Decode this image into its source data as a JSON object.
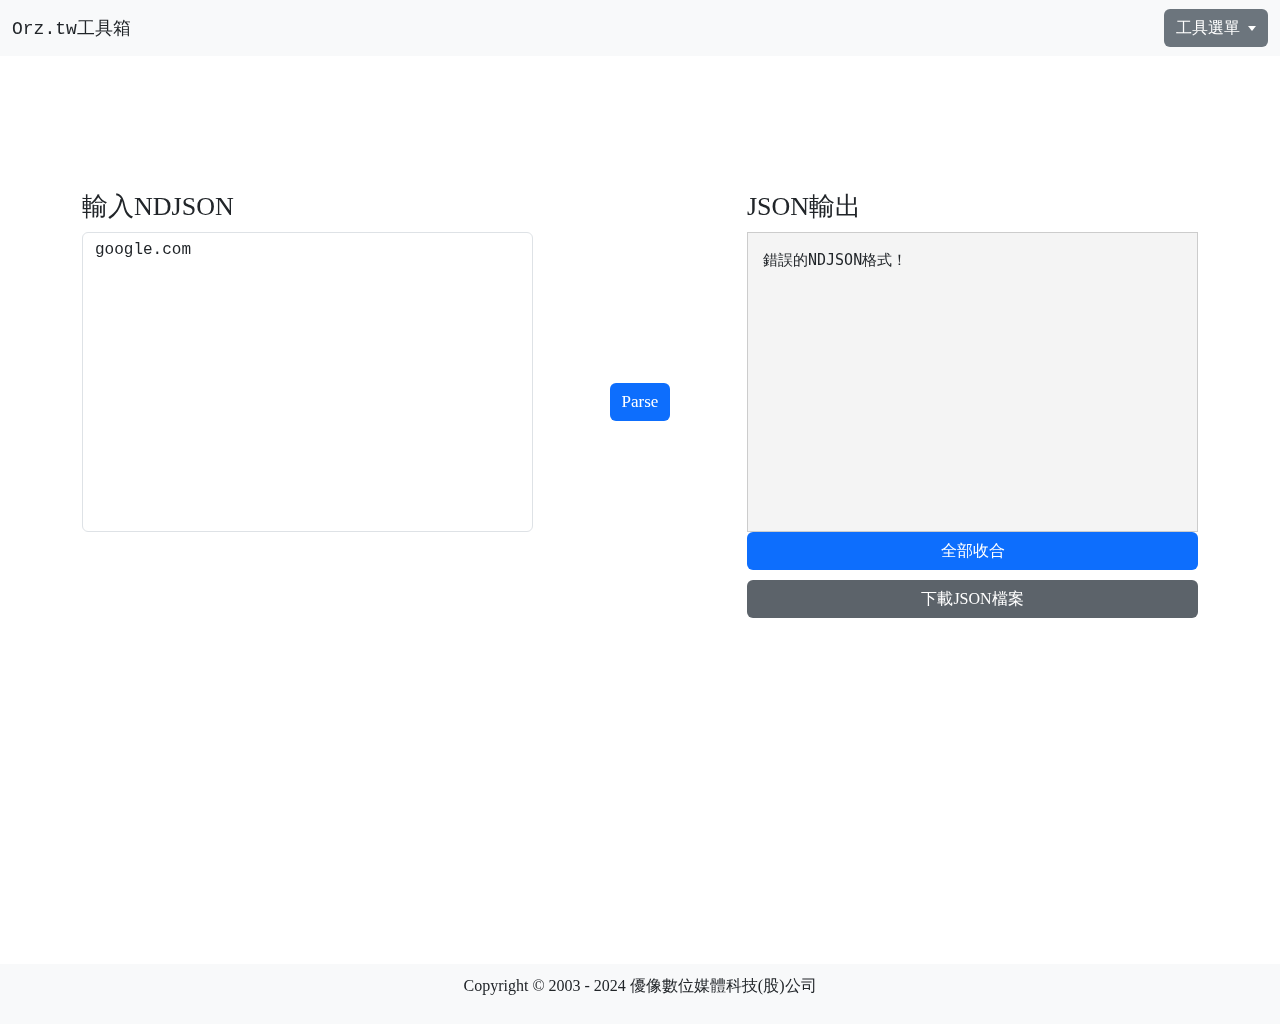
{
  "navbar": {
    "brand": "Orz.tw工具箱",
    "menu_button": "工具選單"
  },
  "input_panel": {
    "title": "輸入NDJSON",
    "value": "google.com"
  },
  "parse_button": "Parse",
  "output_panel": {
    "title": "JSON輸出",
    "message": "錯誤的NDJSON格式！"
  },
  "buttons": [
    {
      "label": "全部收合",
      "kind": "primary"
    },
    {
      "label": "下載JSON檔案",
      "kind": "secondary"
    }
  ],
  "footer": {
    "text": "Copyright © 2003 - 2024 優像數位媒體科技(股)公司"
  }
}
